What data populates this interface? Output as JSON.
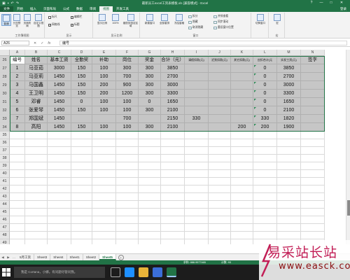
{
  "window": {
    "title": "最新员工excel工资表模板.xls [兼容模式] - Excel",
    "controls": [
      "?",
      "—",
      "□",
      "✕"
    ]
  },
  "ribbon_tabs": [
    {
      "label": "文件",
      "active": false
    },
    {
      "label": "开始",
      "active": false
    },
    {
      "label": "插入",
      "active": false
    },
    {
      "label": "页面布局",
      "active": false
    },
    {
      "label": "公式",
      "active": false
    },
    {
      "label": "数据",
      "active": false
    },
    {
      "label": "审阅",
      "active": false
    },
    {
      "label": "视图",
      "active": true
    },
    {
      "label": "开发工具",
      "active": false
    }
  ],
  "ribbon_right": "登录",
  "ribbon": {
    "workbook_views": {
      "label": "工作簿视图",
      "buttons": [
        "普通",
        "分页预览",
        "页面布局",
        "自定义视图"
      ]
    },
    "show": {
      "label": "显示",
      "checks": [
        {
          "label": "标尺",
          "checked": false
        },
        {
          "label": "编辑栏",
          "checked": true
        },
        {
          "label": "网格线",
          "checked": true
        },
        {
          "label": "标题",
          "checked": true
        }
      ]
    },
    "zoom": {
      "label": "显示比例",
      "buttons": [
        "显示比例",
        "100%",
        "缩放到选定区域"
      ]
    },
    "window": {
      "label": "窗口",
      "buttons": [
        "新建窗口",
        "全部重排",
        "冻结窗格"
      ],
      "small": [
        "拆分",
        "隐藏",
        "取消隐藏",
        "并排查看",
        "同步滚动",
        "重设窗口位置"
      ]
    },
    "switch": {
      "label": "切换窗口"
    },
    "macros": {
      "label": "宏",
      "button": "宏"
    }
  },
  "formula_bar": {
    "name_box": "A26",
    "icons": [
      "✕",
      "✓",
      "fx"
    ],
    "content": "编号"
  },
  "columns": [
    "A",
    "B",
    "C",
    "D",
    "E",
    "F",
    "G",
    "H",
    "I",
    "J",
    "K",
    "L",
    "M",
    "N"
  ],
  "rows": [
    "26",
    "27",
    "28",
    "29",
    "30",
    "31",
    "32",
    "33",
    "34",
    "35",
    "36",
    "37",
    "38",
    "39",
    "40",
    "41",
    "42",
    "43",
    "44",
    "45",
    "46",
    "47",
    "48",
    "49",
    "50"
  ],
  "table": {
    "headers": [
      "编号",
      "姓名",
      "基本工资",
      "全勤奖",
      "补助",
      "岗位",
      "奖金",
      "合计（元）",
      "请假扣款(元)",
      "迟到扣款(元)",
      "其它扣款(元)",
      "应扣合计(元",
      "实发工资(元)",
      "签字"
    ],
    "data": [
      [
        "1",
        "马亚茹",
        "3000",
        "150",
        "100",
        "300",
        "300",
        "3850",
        "",
        "",
        "",
        "0",
        "3850",
        ""
      ],
      [
        "2",
        "马亚莉",
        "1450",
        "150",
        "100",
        "700",
        "300",
        "2700",
        "",
        "",
        "",
        "0",
        "2700",
        ""
      ],
      [
        "3",
        "马国鑫",
        "1450",
        "150",
        "200",
        "900",
        "300",
        "3000",
        "",
        "",
        "",
        "0",
        "3000",
        ""
      ],
      [
        "4",
        "王卫明",
        "1450",
        "150",
        "200",
        "1200",
        "300",
        "3300",
        "",
        "",
        "",
        "0",
        "3300",
        ""
      ],
      [
        "5",
        "邓睿",
        "1450",
        "0",
        "100",
        "100",
        "0",
        "1650",
        "",
        "",
        "",
        "0",
        "1650",
        ""
      ],
      [
        "6",
        "张爱琴",
        "1450",
        "150",
        "100",
        "100",
        "300",
        "2100",
        "",
        "",
        "",
        "0",
        "2100",
        ""
      ],
      [
        "7",
        "郑国斌",
        "1450",
        "",
        "",
        "700",
        "",
        "2150",
        "330",
        "",
        "",
        "330",
        "1820",
        ""
      ],
      [
        "8",
        "高阳",
        "1450",
        "150",
        "100",
        "100",
        "300",
        "2100",
        "",
        "",
        "200",
        "200",
        "1900",
        ""
      ]
    ]
  },
  "sheet_tabs": [
    {
      "label": "5月工资",
      "active": false
    },
    {
      "label": "Sheet3",
      "active": false
    },
    {
      "label": "Sheet4",
      "active": false
    },
    {
      "label": "Sheet1",
      "active": false
    },
    {
      "label": "Sheet2",
      "active": false
    },
    {
      "label": "Sheet5",
      "active": true
    }
  ],
  "status_bar": {
    "sum": "求和: 888.9577465",
    "count": "计数: 93",
    "numeric_count": "求和"
  },
  "taskbar": {
    "search_placeholder": "我是 Cortana，小娜。有问题尽管问我。"
  },
  "watermark": {
    "main": "易采站长站",
    "url": "www.easck.com"
  },
  "colors": {
    "excel_green": "#217346",
    "selection_gray": "#c6c6c6",
    "watermark_red": "#c21e56"
  }
}
